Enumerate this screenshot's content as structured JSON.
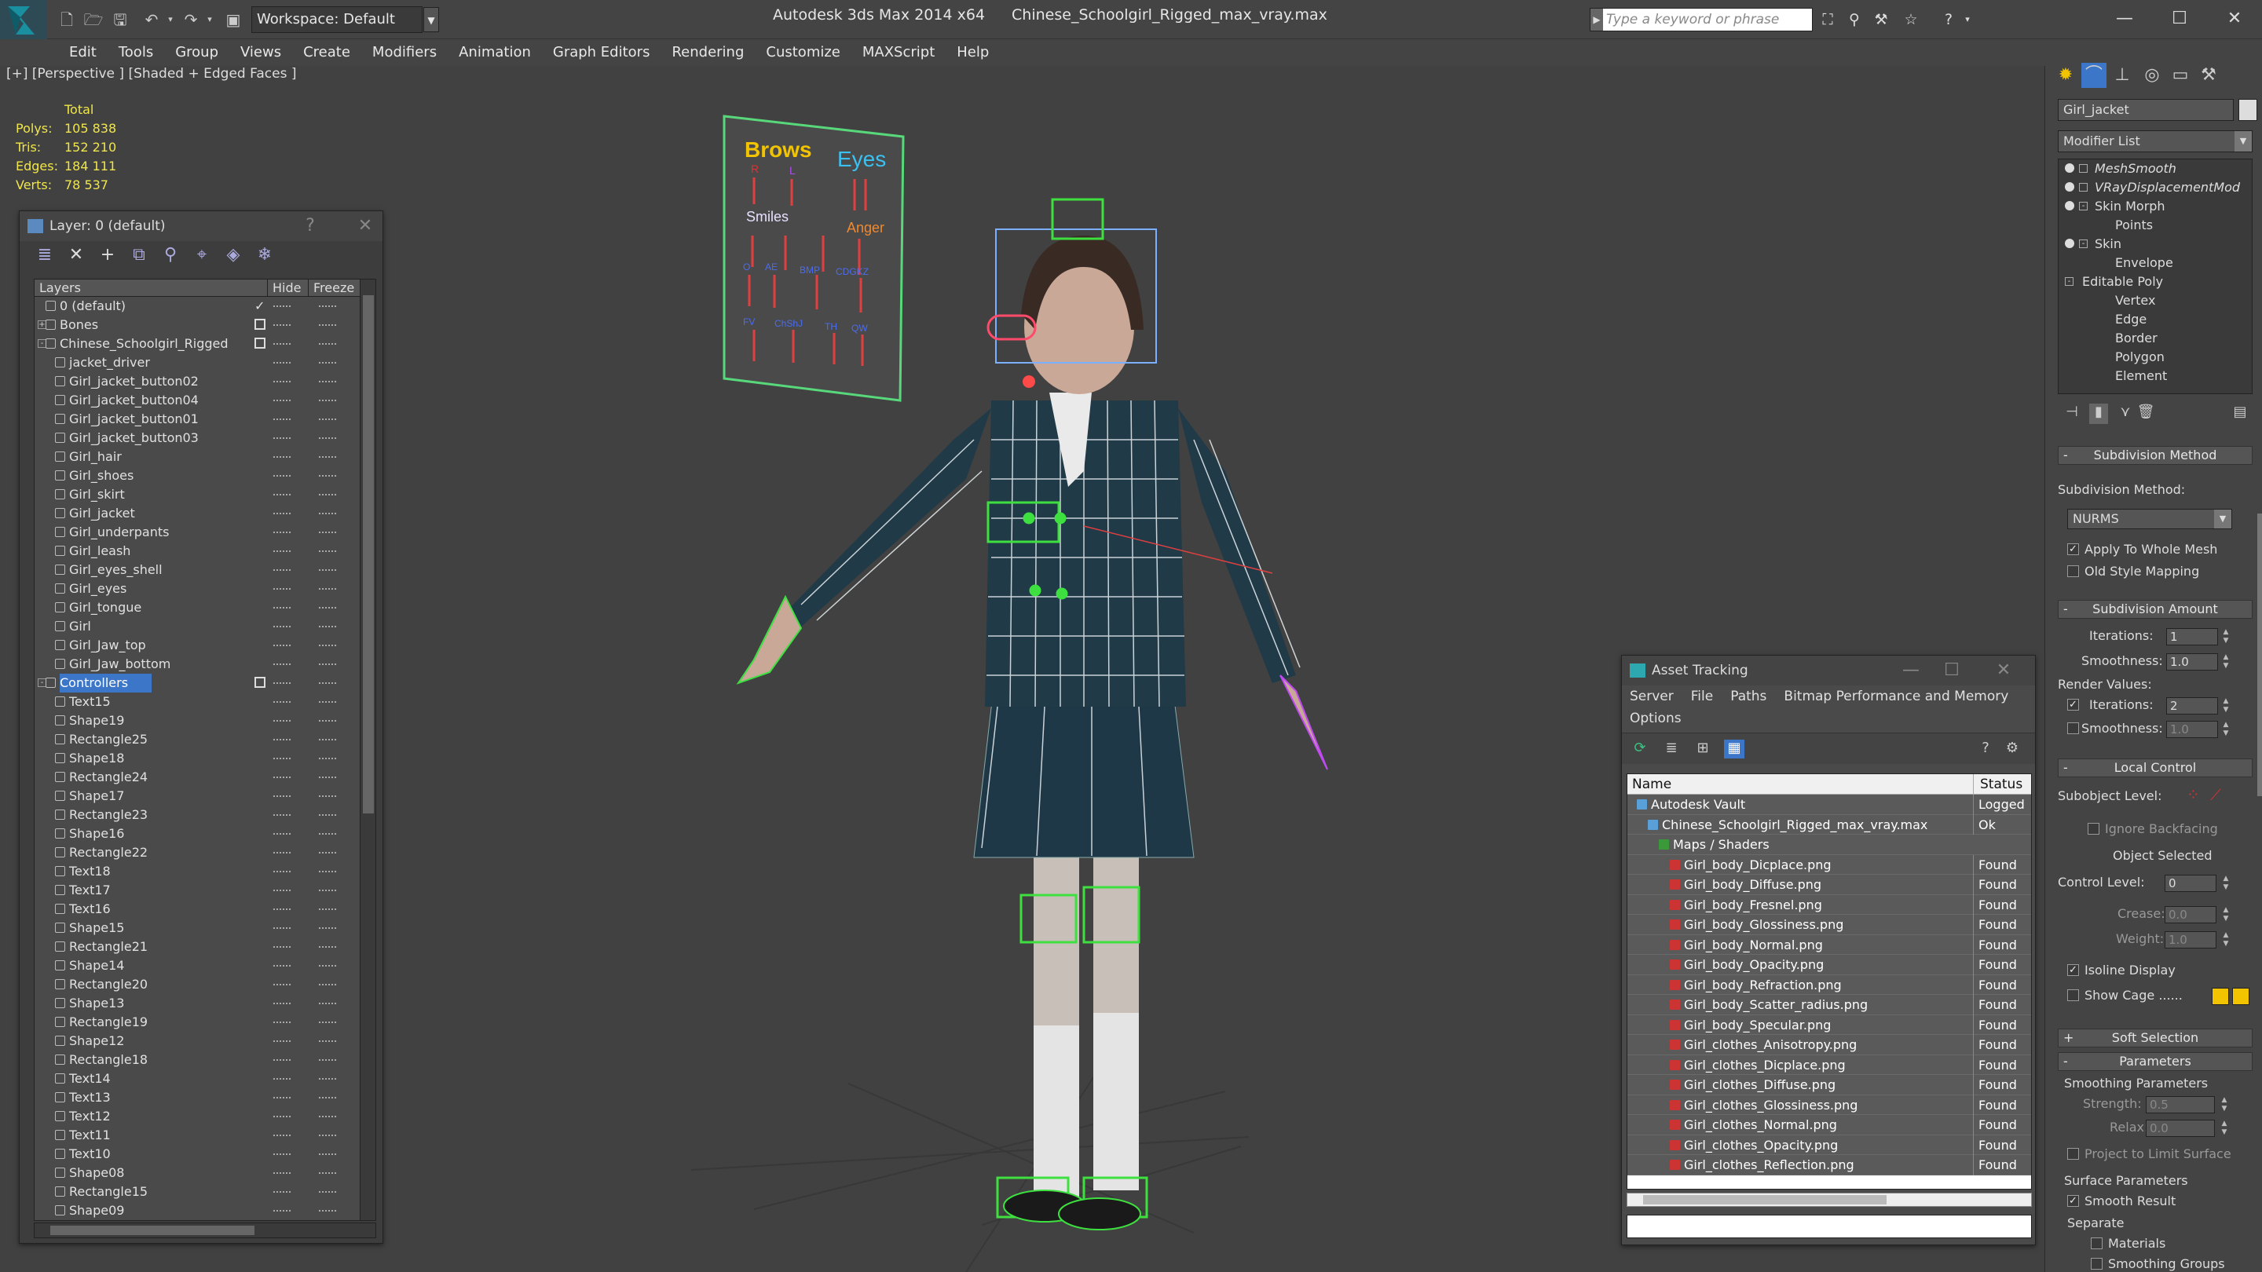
{
  "titlebar": {
    "workspace": "Workspace: Default",
    "app_name": "Autodesk 3ds Max  2014 x64",
    "file_name": "Chinese_Schoolgirl_Rigged_max_vray.max",
    "search_placeholder": "Type a keyword or phrase"
  },
  "menu": [
    "Edit",
    "Tools",
    "Group",
    "Views",
    "Create",
    "Modifiers",
    "Animation",
    "Graph Editors",
    "Rendering",
    "Customize",
    "MAXScript",
    "Help"
  ],
  "viewport": {
    "label": "[+] [Perspective ] [Shaded + Edged Faces ]",
    "stats": {
      "header": "Total",
      "rows": [
        {
          "label": "Polys:",
          "value": "105 838"
        },
        {
          "label": "Tris:",
          "value": "152 210"
        },
        {
          "label": "Edges:",
          "value": "184 111"
        },
        {
          "label": "Verts:",
          "value": "78 537"
        }
      ]
    },
    "board": {
      "brows": "Brows",
      "eyes": "Eyes",
      "smiles": "Smiles",
      "anger": "Anger",
      "r": "R",
      "l": "L"
    }
  },
  "layer_panel": {
    "title": "Layer: 0 (default)",
    "help": "?",
    "columns": {
      "layers": "Layers",
      "hide": "Hide",
      "freeze": "Freeze"
    },
    "rows": [
      {
        "name": "0 (default)",
        "level": 0,
        "type": "layer",
        "check": "current"
      },
      {
        "name": "Bones",
        "level": 0,
        "type": "layer",
        "expand": "+",
        "check": "box"
      },
      {
        "name": "Chinese_Schoolgirl_Rigged",
        "level": 0,
        "type": "layer",
        "expand": "-",
        "check": "box"
      },
      {
        "name": "jacket_driver",
        "level": 1,
        "type": "obj"
      },
      {
        "name": "Girl_jacket_button02",
        "level": 1,
        "type": "obj"
      },
      {
        "name": "Girl_jacket_button04",
        "level": 1,
        "type": "obj"
      },
      {
        "name": "Girl_jacket_button01",
        "level": 1,
        "type": "obj"
      },
      {
        "name": "Girl_jacket_button03",
        "level": 1,
        "type": "obj"
      },
      {
        "name": "Girl_hair",
        "level": 1,
        "type": "obj"
      },
      {
        "name": "Girl_shoes",
        "level": 1,
        "type": "obj"
      },
      {
        "name": "Girl_skirt",
        "level": 1,
        "type": "obj"
      },
      {
        "name": "Girl_jacket",
        "level": 1,
        "type": "obj"
      },
      {
        "name": "Girl_underpants",
        "level": 1,
        "type": "obj"
      },
      {
        "name": "Girl_leash",
        "level": 1,
        "type": "obj"
      },
      {
        "name": "Girl_eyes_shell",
        "level": 1,
        "type": "obj"
      },
      {
        "name": "Girl_eyes",
        "level": 1,
        "type": "obj"
      },
      {
        "name": "Girl_tongue",
        "level": 1,
        "type": "obj"
      },
      {
        "name": "Girl",
        "level": 1,
        "type": "obj"
      },
      {
        "name": "Girl_Jaw_top",
        "level": 1,
        "type": "obj"
      },
      {
        "name": "Girl_Jaw_bottom",
        "level": 1,
        "type": "obj"
      },
      {
        "name": "Controllers",
        "level": 0,
        "type": "layer",
        "expand": "-",
        "check": "box",
        "selected": true
      },
      {
        "name": "Text15",
        "level": 1,
        "type": "obj"
      },
      {
        "name": "Shape19",
        "level": 1,
        "type": "obj"
      },
      {
        "name": "Rectangle25",
        "level": 1,
        "type": "obj"
      },
      {
        "name": "Shape18",
        "level": 1,
        "type": "obj"
      },
      {
        "name": "Rectangle24",
        "level": 1,
        "type": "obj"
      },
      {
        "name": "Shape17",
        "level": 1,
        "type": "obj"
      },
      {
        "name": "Rectangle23",
        "level": 1,
        "type": "obj"
      },
      {
        "name": "Shape16",
        "level": 1,
        "type": "obj"
      },
      {
        "name": "Rectangle22",
        "level": 1,
        "type": "obj"
      },
      {
        "name": "Text18",
        "level": 1,
        "type": "obj"
      },
      {
        "name": "Text17",
        "level": 1,
        "type": "obj"
      },
      {
        "name": "Text16",
        "level": 1,
        "type": "obj"
      },
      {
        "name": "Shape15",
        "level": 1,
        "type": "obj"
      },
      {
        "name": "Rectangle21",
        "level": 1,
        "type": "obj"
      },
      {
        "name": "Shape14",
        "level": 1,
        "type": "obj"
      },
      {
        "name": "Rectangle20",
        "level": 1,
        "type": "obj"
      },
      {
        "name": "Shape13",
        "level": 1,
        "type": "obj"
      },
      {
        "name": "Rectangle19",
        "level": 1,
        "type": "obj"
      },
      {
        "name": "Shape12",
        "level": 1,
        "type": "obj"
      },
      {
        "name": "Rectangle18",
        "level": 1,
        "type": "obj"
      },
      {
        "name": "Text14",
        "level": 1,
        "type": "obj"
      },
      {
        "name": "Text13",
        "level": 1,
        "type": "obj"
      },
      {
        "name": "Text12",
        "level": 1,
        "type": "obj"
      },
      {
        "name": "Text11",
        "level": 1,
        "type": "obj"
      },
      {
        "name": "Text10",
        "level": 1,
        "type": "obj"
      },
      {
        "name": "Shape08",
        "level": 1,
        "type": "obj"
      },
      {
        "name": "Rectangle15",
        "level": 1,
        "type": "obj"
      },
      {
        "name": "Shape09",
        "level": 1,
        "type": "obj"
      }
    ]
  },
  "asset_panel": {
    "title": "Asset Tracking",
    "menu": [
      "Server",
      "File",
      "Paths",
      "Bitmap Performance and Memory",
      "Options"
    ],
    "columns": {
      "name": "Name",
      "status": "Status"
    },
    "rows": [
      {
        "name": "Autodesk Vault",
        "status": "Logged",
        "level": 0,
        "icon": "vault"
      },
      {
        "name": "Chinese_Schoolgirl_Rigged_max_vray.max",
        "status": "Ok",
        "level": 1,
        "icon": "file"
      },
      {
        "name": "Maps / Shaders",
        "status": "",
        "level": 2,
        "icon": "maps"
      },
      {
        "name": "Girl_body_Dicplace.png",
        "status": "Found",
        "level": 3,
        "icon": "png"
      },
      {
        "name": "Girl_body_Diffuse.png",
        "status": "Found",
        "level": 3,
        "icon": "png"
      },
      {
        "name": "Girl_body_Fresnel.png",
        "status": "Found",
        "level": 3,
        "icon": "png"
      },
      {
        "name": "Girl_body_Glossiness.png",
        "status": "Found",
        "level": 3,
        "icon": "png"
      },
      {
        "name": "Girl_body_Normal.png",
        "status": "Found",
        "level": 3,
        "icon": "png"
      },
      {
        "name": "Girl_body_Opacity.png",
        "status": "Found",
        "level": 3,
        "icon": "png"
      },
      {
        "name": "Girl_body_Refraction.png",
        "status": "Found",
        "level": 3,
        "icon": "png"
      },
      {
        "name": "Girl_body_Scatter_radius.png",
        "status": "Found",
        "level": 3,
        "icon": "png"
      },
      {
        "name": "Girl_body_Specular.png",
        "status": "Found",
        "level": 3,
        "icon": "png"
      },
      {
        "name": "Girl_clothes_Anisotropy.png",
        "status": "Found",
        "level": 3,
        "icon": "png"
      },
      {
        "name": "Girl_clothes_Dicplace.png",
        "status": "Found",
        "level": 3,
        "icon": "png"
      },
      {
        "name": "Girl_clothes_Diffuse.png",
        "status": "Found",
        "level": 3,
        "icon": "png"
      },
      {
        "name": "Girl_clothes_Glossiness.png",
        "status": "Found",
        "level": 3,
        "icon": "png"
      },
      {
        "name": "Girl_clothes_Normal.png",
        "status": "Found",
        "level": 3,
        "icon": "png"
      },
      {
        "name": "Girl_clothes_Opacity.png",
        "status": "Found",
        "level": 3,
        "icon": "png"
      },
      {
        "name": "Girl_clothes_Reflection.png",
        "status": "Found",
        "level": 3,
        "icon": "png"
      }
    ]
  },
  "command_panel": {
    "object_name": "Girl_jacket",
    "modifier_list": "Modifier List",
    "stack": [
      {
        "name": "MeshSmooth",
        "level": 0,
        "bulb": true,
        "box": "",
        "italic": true
      },
      {
        "name": "VRayDisplacementMod",
        "level": 0,
        "bulb": true,
        "box": "",
        "italic": true
      },
      {
        "name": "Skin Morph",
        "level": 0,
        "bulb": true,
        "box": "-"
      },
      {
        "name": "Points",
        "level": 1
      },
      {
        "name": "Skin",
        "level": 0,
        "bulb": true,
        "box": "-"
      },
      {
        "name": "Envelope",
        "level": 1
      },
      {
        "name": "Editable Poly",
        "level": 0,
        "box": "-"
      },
      {
        "name": "Vertex",
        "level": 1
      },
      {
        "name": "Edge",
        "level": 1
      },
      {
        "name": "Border",
        "level": 1
      },
      {
        "name": "Polygon",
        "level": 1
      },
      {
        "name": "Element",
        "level": 1
      }
    ],
    "subdivision_method": {
      "header": "Subdivision Method",
      "label": "Subdivision Method:",
      "value": "NURMS",
      "apply_whole": "Apply To Whole Mesh",
      "old_style": "Old Style Mapping"
    },
    "subdivision_amount": {
      "header": "Subdivision Amount",
      "iterations_label": "Iterations:",
      "iterations": "1",
      "smoothness_label": "Smoothness:",
      "smoothness": "1.0",
      "render_values": "Render Values:",
      "r_iterations": "2",
      "r_smoothness": "1.0"
    },
    "local_control": {
      "header": "Local Control",
      "subobject_level": "Subobject Level:",
      "ignore_backfacing": "Ignore Backfacing",
      "object_selected": "Object Selected",
      "control_level_label": "Control Level:",
      "control_level": "0",
      "crease_label": "Crease:",
      "crease": "0.0",
      "weight_label": "Weight:",
      "weight": "1.0",
      "isoline": "Isoline Display",
      "show_cage": "Show Cage ......"
    },
    "soft_selection": {
      "header": "Soft Selection"
    },
    "parameters": {
      "header": "Parameters",
      "smoothing_params": "Smoothing Parameters",
      "strength_label": "Strength:",
      "strength": "0.5",
      "relax_label": "Relax:",
      "relax": "0.0",
      "project": "Project to Limit Surface",
      "surface_params": "Surface Parameters",
      "smooth_result": "Smooth Result",
      "separate": "Separate",
      "materials": "Materials",
      "smoothing_groups": "Smoothing Groups"
    }
  },
  "colors": {
    "accent": "#3b76c9",
    "stats": "#f0e64a",
    "board_border": "#58d87a",
    "cage_yellow": "#f2c400"
  }
}
